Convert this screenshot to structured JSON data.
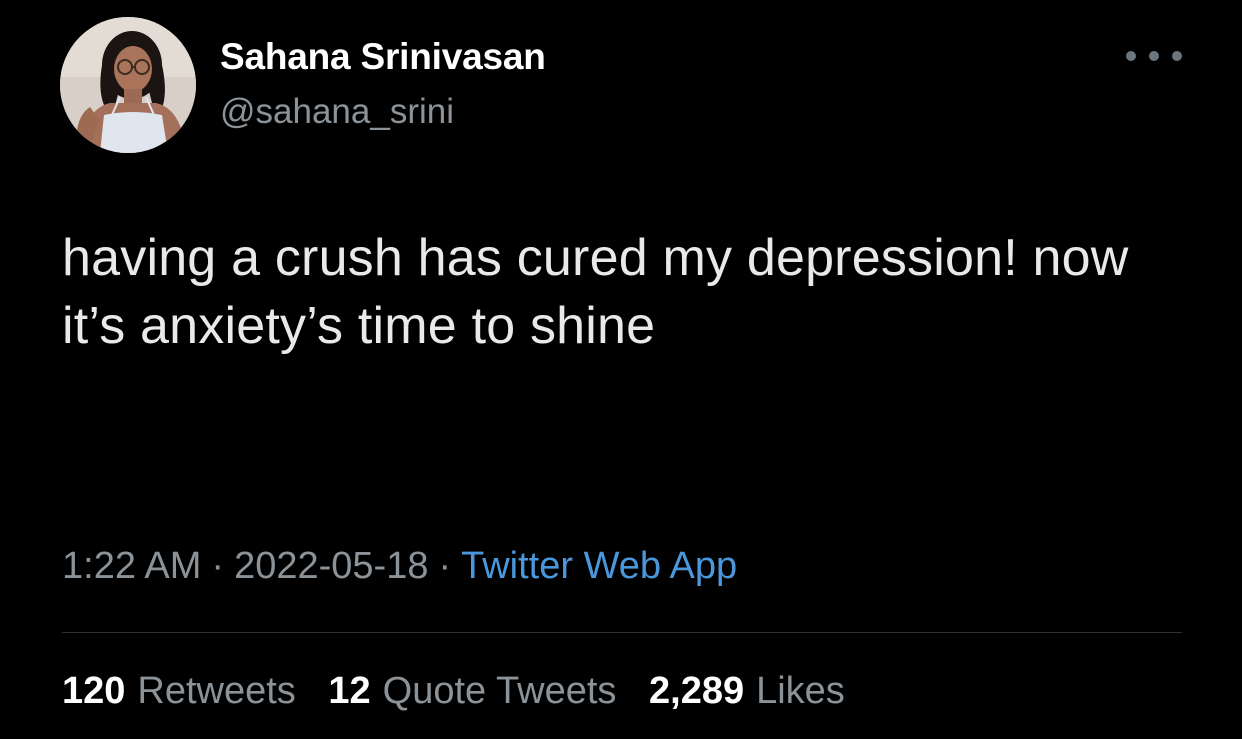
{
  "user": {
    "display_name": "Sahana Srinivasan",
    "handle": "@sahana_srini"
  },
  "tweet": {
    "text": "having a crush has cured my depression! now it’s anxiety’s time to shine",
    "time": "1:22 AM",
    "date": "2022-05-18",
    "separator": "·",
    "source": "Twitter Web App"
  },
  "stats": {
    "retweets": {
      "count": "120",
      "label": "Retweets"
    },
    "quotes": {
      "count": "12",
      "label": "Quote Tweets"
    },
    "likes": {
      "count": "2,289",
      "label": "Likes"
    }
  },
  "icons": {
    "more": "more-horizontal-icon"
  },
  "colors": {
    "background": "#000000",
    "primary_text": "#e7e9ea",
    "secondary_text": "#8b9298",
    "link": "#4a97db",
    "divider": "#2f3336"
  }
}
